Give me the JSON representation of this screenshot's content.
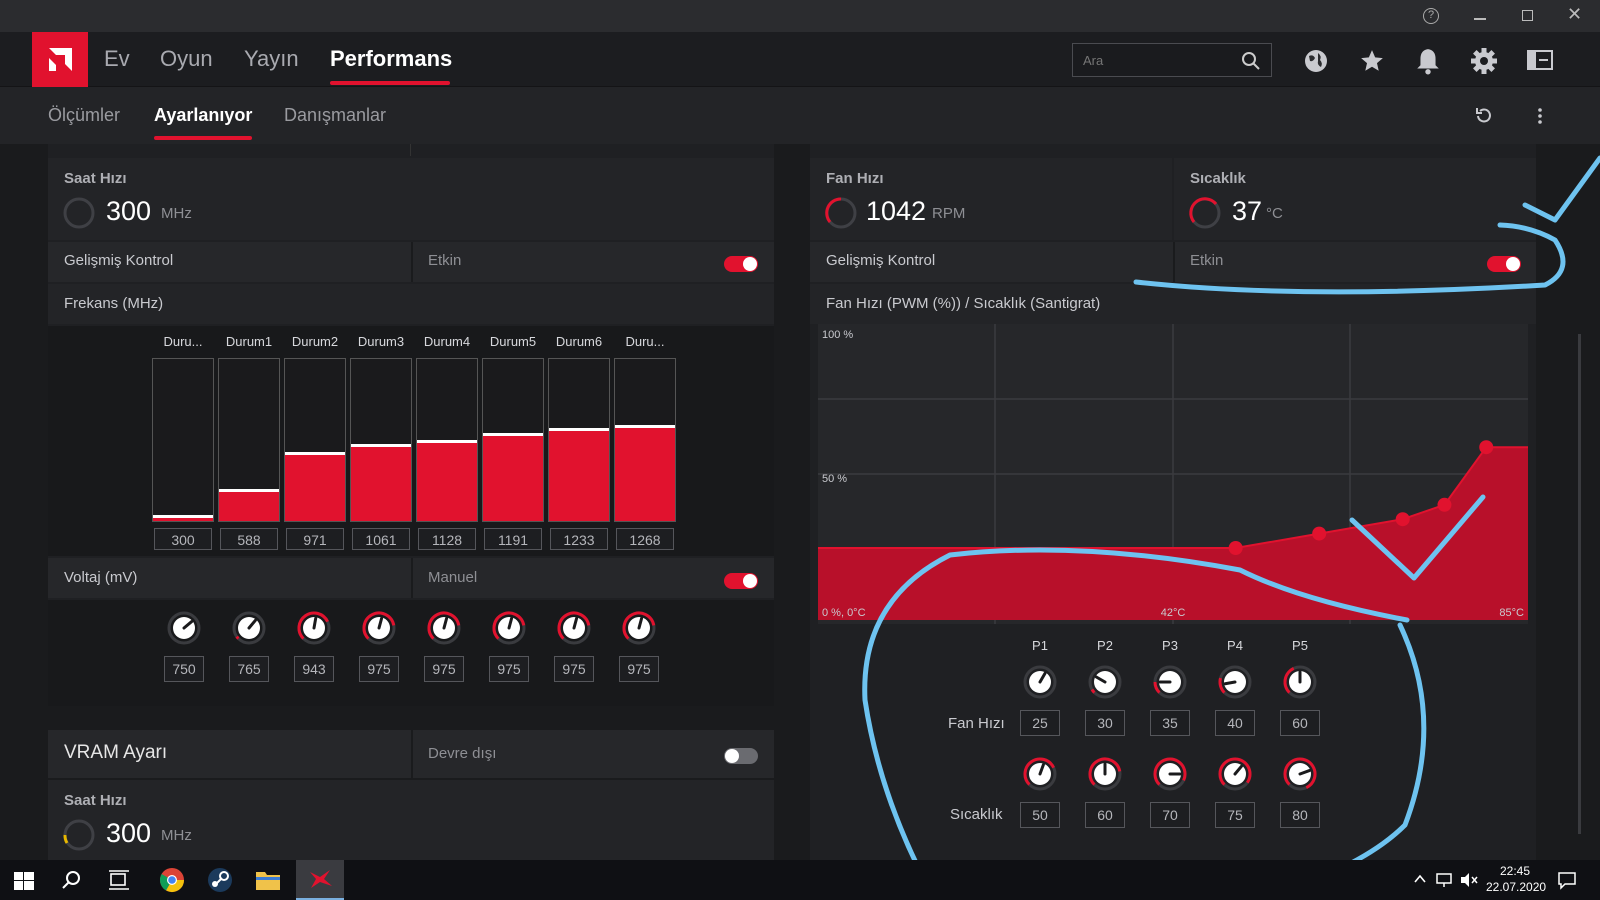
{
  "title_bar": {
    "help_icon": "help-icon",
    "minimize_icon": "minimize-icon",
    "restore_icon": "restore-icon",
    "close_icon": "close-icon"
  },
  "nav": {
    "tabs": [
      {
        "label": "Ev"
      },
      {
        "label": "Oyun"
      },
      {
        "label": "Yayın"
      },
      {
        "label": "Performans"
      }
    ],
    "search_placeholder": "Ara",
    "accent": "#e1122e"
  },
  "subnav": {
    "tabs": [
      {
        "label": "Ölçümler"
      },
      {
        "label": "Ayarlanıyor"
      },
      {
        "label": "Danışmanlar"
      }
    ]
  },
  "gpu": {
    "clock_label": "Saat Hızı",
    "clock_value": "300",
    "clock_unit": "MHz",
    "advanced_label": "Gelişmiş Kontrol",
    "advanced_state": "Etkin",
    "advanced_on": true,
    "freq_title": "Frekans (MHz)",
    "states": [
      "Duru...",
      "Durum1",
      "Durum2",
      "Durum3",
      "Durum4",
      "Durum5",
      "Durum6",
      "Duru..."
    ],
    "freq_values": [
      "300",
      "588",
      "971",
      "1061",
      "1128",
      "1191",
      "1233",
      "1268"
    ],
    "freq_levels": [
      0.02,
      0.18,
      0.41,
      0.46,
      0.49,
      0.53,
      0.56,
      0.58
    ],
    "voltage_label": "Voltaj (mV)",
    "voltage_mode": "Manuel",
    "voltage_on": true,
    "voltage_values": [
      "750",
      "765",
      "943",
      "975",
      "975",
      "975",
      "975",
      "975"
    ]
  },
  "vram": {
    "title": "VRAM Ayarı",
    "state": "Devre dışı",
    "enabled": false,
    "clock_label": "Saat Hızı",
    "clock_value": "300",
    "clock_unit": "MHz"
  },
  "fan": {
    "speed_label": "Fan Hızı",
    "speed_value": "1042",
    "speed_unit": "RPM",
    "temp_label": "Sıcaklık",
    "temp_value": "37",
    "temp_unit": "°C",
    "advanced_label": "Gelişmiş Kontrol",
    "advanced_state": "Etkin",
    "advanced_on": true,
    "curve_title": "Fan Hızı (PWM (%)) / Sıcaklık (Santigrat)",
    "points": [
      "P1",
      "P2",
      "P3",
      "P4",
      "P5"
    ],
    "fan_row_label": "Fan Hızı",
    "fan_values": [
      "25",
      "30",
      "35",
      "40",
      "60"
    ],
    "temp_row_label": "Sıcaklık",
    "temp_values": [
      "50",
      "60",
      "70",
      "75",
      "80"
    ]
  },
  "chart_data": {
    "type": "area",
    "title": "Fan Hızı (PWM (%)) / Sıcaklık (Santigrat)",
    "y_ticks": [
      "100 %",
      "50 %",
      "0 %, 0°C"
    ],
    "x_ticks": [
      "42°C",
      "85°C"
    ],
    "ylim": [
      0,
      100
    ],
    "xlim": [
      0,
      85
    ],
    "series": [
      {
        "x": [
          0,
          50,
          60,
          70,
          75,
          80,
          85
        ],
        "y": [
          25,
          25,
          30,
          35,
          40,
          60,
          60
        ]
      }
    ],
    "grid": true
  },
  "taskbar": {
    "time": "22:45",
    "date": "22.07.2020"
  }
}
